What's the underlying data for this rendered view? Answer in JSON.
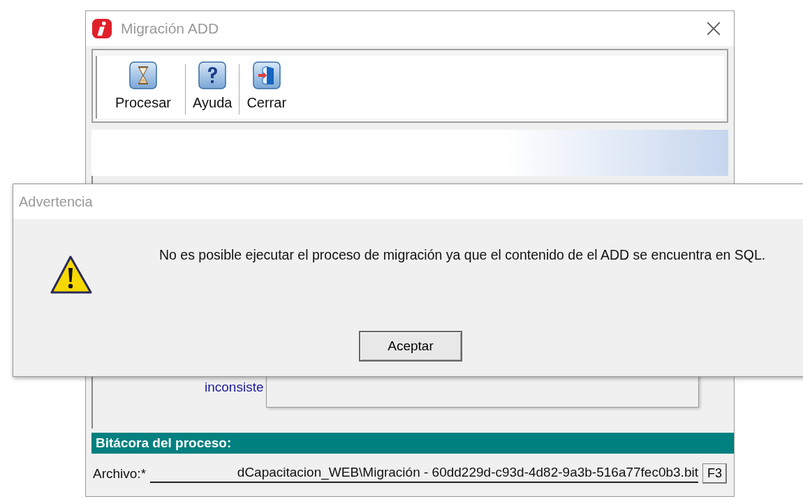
{
  "window": {
    "title": "Migración ADD"
  },
  "toolbar": [
    {
      "label": "Procesar",
      "kind": "hourglass"
    },
    {
      "label": "Ayuda",
      "kind": "help"
    },
    {
      "label": "Cerrar",
      "kind": "exit"
    }
  ],
  "background_text": "inconsiste",
  "log_section": {
    "title": "Bitácora del proceso:",
    "file_label": "Archivo:*",
    "file_value": "dCapacitacion_WEB\\Migración - 60dd229d-c93d-4d82-9a3b-516a77fec0b3.bit",
    "browse_button": "F3"
  },
  "dialog": {
    "title": "Advertencia",
    "kind": "warning",
    "message": "No es posible ejecutar el proceso de migración ya que el contenido de el ADD se encuentra en SQL.",
    "button": "Aceptar"
  }
}
